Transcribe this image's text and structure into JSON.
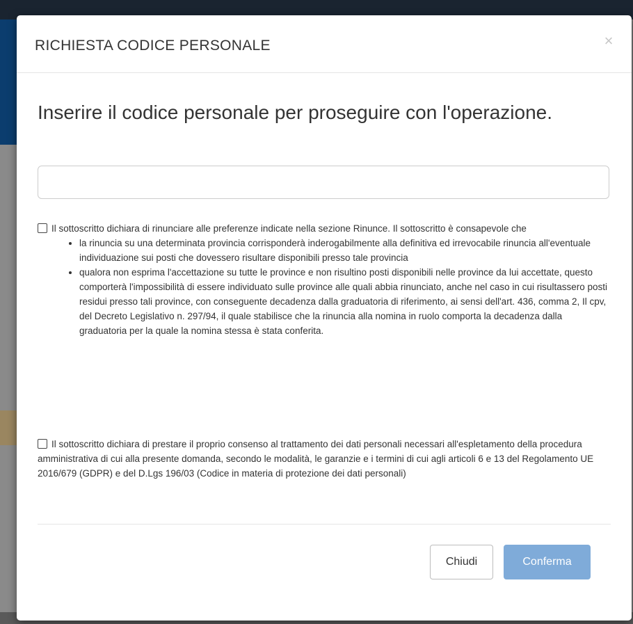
{
  "modal": {
    "title": "RICHIESTA CODICE PERSONALE",
    "close_glyph": "×",
    "lead": "Inserire il codice personale per proseguire con l'operazione.",
    "input": {
      "value": "",
      "placeholder": ""
    },
    "declaration_1": {
      "checked": false,
      "text": "Il sottoscritto dichiara di rinunciare alle preferenze indicate nella sezione Rinunce. Il sottoscritto è consapevole che",
      "bullets": [
        "la rinuncia su una determinata provincia corrisponderà inderogabilmente alla definitiva ed irrevocabile rinuncia all'eventuale individuazione sui posti che dovessero risultare disponibili presso tale provincia",
        "qualora non esprima l'accettazione su tutte le province e non risultino posti disponibili nelle province da lui accettate, questo comporterà l'impossibilità di essere individuato sulle province alle quali abbia rinunciato, anche nel caso in cui risultassero posti residui presso tali province, con conseguente decadenza dalla graduatoria di riferimento, ai sensi dell'art. 436, comma 2, Il cpv, del Decreto Legislativo n. 297/94, il quale stabilisce che la rinuncia alla nomina in ruolo comporta la decadenza dalla graduatoria per la quale la nomina stessa è stata conferita."
      ]
    },
    "declaration_2": {
      "checked": false,
      "text": "Il sottoscritto dichiara di prestare il proprio consenso al trattamento dei dati personali necessari all'espletamento della procedura amministrativa di cui alla presente domanda, secondo le modalità, le garanzie e i termini di cui agli articoli 6 e 13 del Regolamento UE 2016/679 (GDPR) e del D.Lgs 196/03 (Codice in materia di protezione dei dati personali)"
    },
    "buttons": {
      "close_label": "Chiudi",
      "confirm_label": "Conferma"
    }
  },
  "colors": {
    "confirm_button": "#7fabd9",
    "overlay": "#7a7a7a"
  }
}
